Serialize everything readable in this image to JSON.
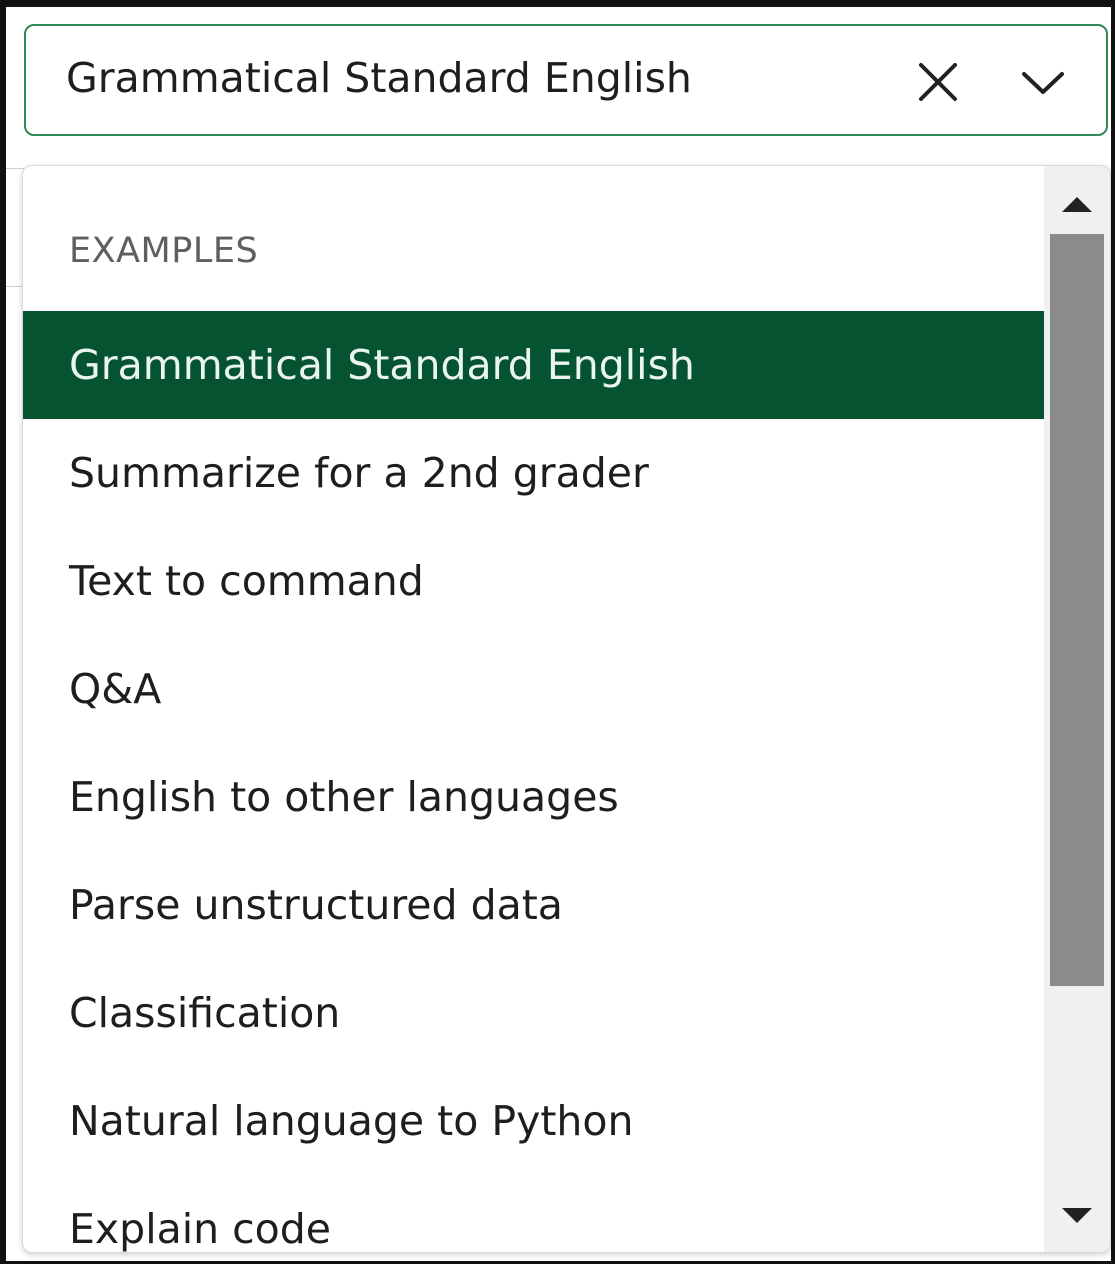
{
  "select": {
    "value": "Grammatical Standard English",
    "clear_icon": "close-icon",
    "toggle_icon": "chevron-down-icon",
    "border_color": "#2e8b57"
  },
  "dropdown": {
    "group_label": "EXAMPLES",
    "selected_color": "#055330",
    "options": [
      {
        "label": "Grammatical Standard English",
        "selected": true
      },
      {
        "label": "Summarize for a 2nd grader",
        "selected": false
      },
      {
        "label": "Text to command",
        "selected": false
      },
      {
        "label": "Q&A",
        "selected": false
      },
      {
        "label": "English to other languages",
        "selected": false
      },
      {
        "label": "Parse unstructured data",
        "selected": false
      },
      {
        "label": "Classification",
        "selected": false
      },
      {
        "label": "Natural language to Python",
        "selected": false
      },
      {
        "label": "Explain code",
        "selected": false
      }
    ]
  },
  "scrollbar": {
    "up_icon": "triangle-up-icon",
    "down_icon": "triangle-down-icon"
  }
}
